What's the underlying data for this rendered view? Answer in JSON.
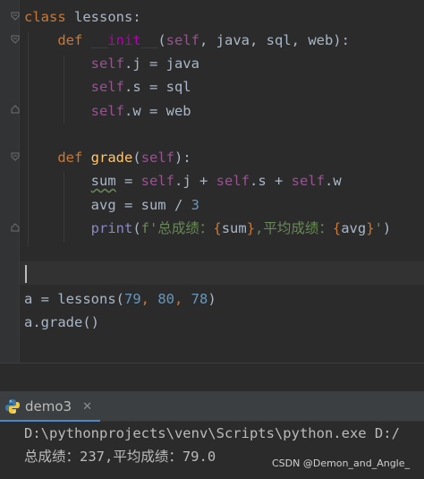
{
  "editor": {
    "lines": {
      "l1": {
        "kw": "class",
        "name": " lessons:"
      },
      "l2": {
        "kw": "def",
        "fn": "__init__",
        "open": "(",
        "self": "self",
        "params": ", java, sql, web):"
      },
      "l3": {
        "self": "self",
        "rest": ".j = java"
      },
      "l4": {
        "self": "self",
        "rest": ".s = sql"
      },
      "l5": {
        "self": "self",
        "rest": ".w = web"
      },
      "l7": {
        "kw": "def",
        "fn": "grade",
        "open": "(",
        "self": "self",
        "close": "):"
      },
      "l8": {
        "var": "sum",
        "eq": " = ",
        "self1": "self",
        "p1": ".j + ",
        "self2": "self",
        "p2": ".s + ",
        "self3": "self",
        "p3": ".w"
      },
      "l9": {
        "pre": "avg = sum / ",
        "num": "3"
      },
      "l10": {
        "builtin": "print",
        "open": "(",
        "str1": "f'总成绩：",
        "b1": "{",
        "e1": "sum",
        "b2": "}",
        "str2": ",平均成绩：",
        "b3": "{",
        "e2": "avg",
        "b4": "}",
        "str3": "'",
        "close": ")"
      },
      "l13": {
        "pre": "a = lessons(",
        "n1": "79",
        "c1": ", ",
        "n2": "80",
        "c2": ", ",
        "n3": "78",
        "close": ")"
      },
      "l14": {
        "text": "a.grade()"
      }
    }
  },
  "run": {
    "tab_label": "demo3",
    "close_glyph": "✕"
  },
  "console": {
    "command": "D:\\pythonprojects\\venv\\Scripts\\python.exe D:/",
    "output": "总成绩：237,平均成绩：79.0"
  },
  "watermark": "CSDN @Demon_and_Angle_",
  "colors": {
    "background": "#2b2b2b",
    "keyword": "#cc7832",
    "self": "#94558d",
    "function": "#ffc66d",
    "number": "#6897bb",
    "string": "#6a8759",
    "tab_accent": "#4a88c7"
  }
}
